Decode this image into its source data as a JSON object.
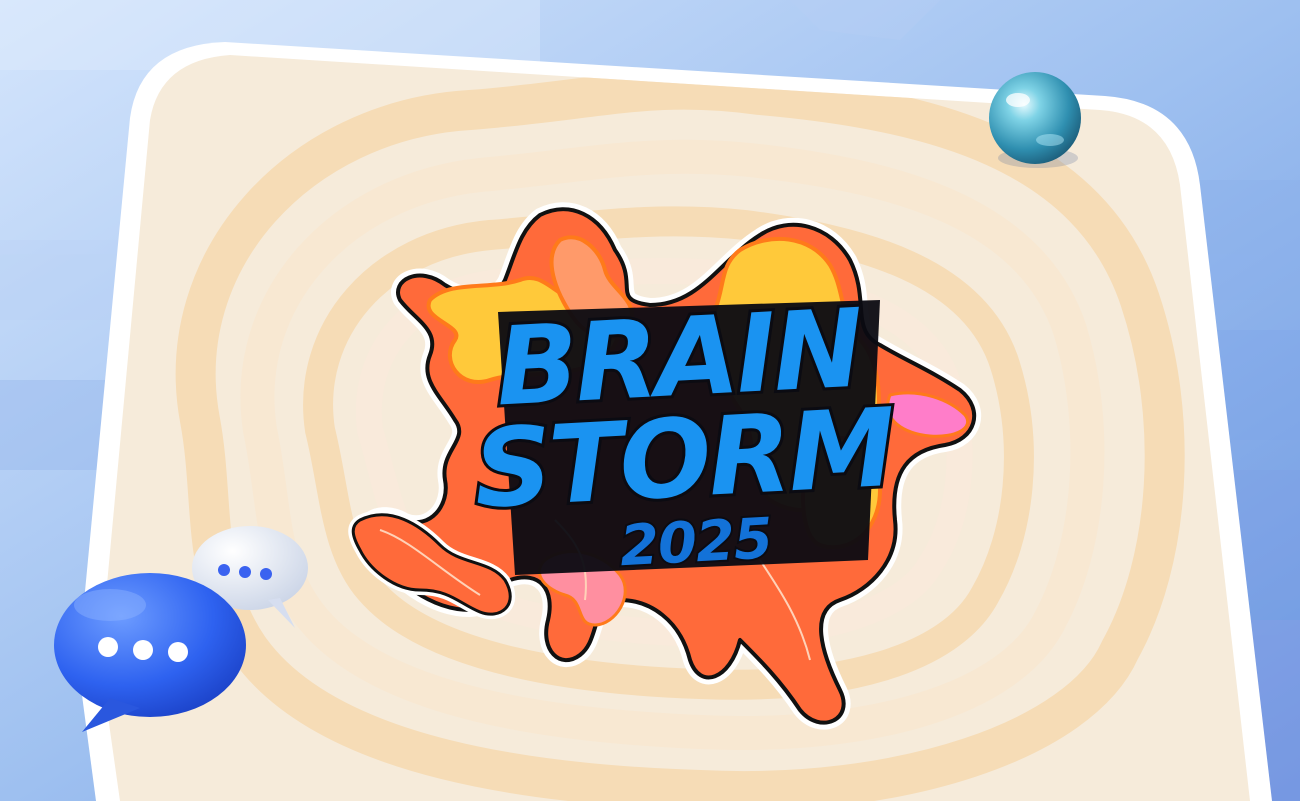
{
  "logo": {
    "line1": "BRAIN",
    "line2": "STORM",
    "year": "2025"
  },
  "colors": {
    "background_top": "#cfe1fb",
    "background_bottom": "#6f9fe3",
    "card_border": "#ffffff",
    "card_fill": "#f7ecdc",
    "ring_dark": "#f7ddb8",
    "ring_light": "#faeedd",
    "logo_text": "#1a93f1",
    "logo_text_dark": "#1372d8",
    "logo_shadow": "#0b0b12",
    "splat_orange": "#ff6a3a",
    "splat_yellow": "#ffc93a",
    "splat_pink": "#ff7dc9",
    "splat_peach": "#ff9a6a",
    "splat_outline": "#ff7a1a",
    "bubble_blue": "#2e66f5",
    "bubble_white": "#eef1f7",
    "pin_teal": "#3aa6c4"
  },
  "decorations": {
    "pin": "teal-pushpin-icon",
    "chat_bubble_front": "blue-chat-bubble-icon",
    "chat_bubble_back": "white-chat-bubble-icon",
    "ellipsis": "ellipsis-dots-icon"
  }
}
